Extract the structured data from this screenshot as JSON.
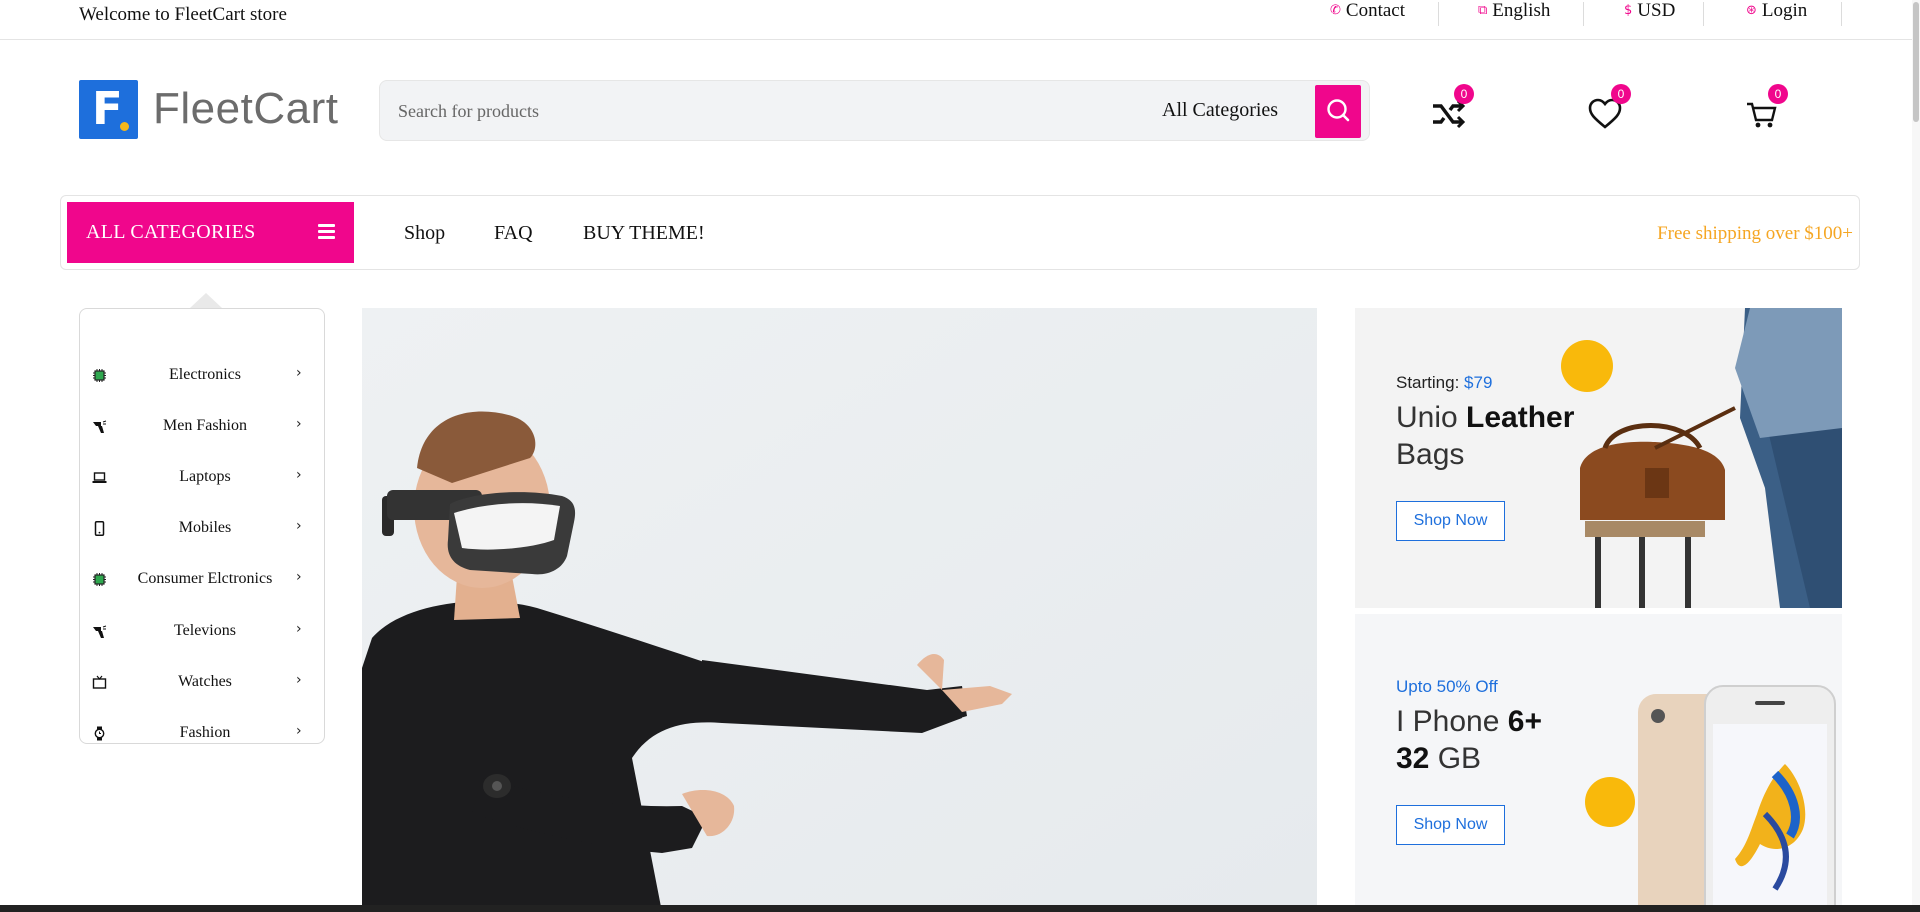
{
  "topbar": {
    "welcome": "Welcome to FleetCart store",
    "links": [
      {
        "label": "Contact",
        "icon": "phone-icon"
      },
      {
        "label": "English",
        "icon": "language-icon"
      },
      {
        "label": "USD",
        "icon": "dollar-icon"
      },
      {
        "label": "Login",
        "icon": "login-icon"
      }
    ]
  },
  "header": {
    "logo_text": "FleetCart",
    "search": {
      "placeholder": "Search for products",
      "category": "All Categories"
    },
    "badges": {
      "compare": "0",
      "wishlist": "0",
      "cart": "0"
    }
  },
  "nav": {
    "all_categories": "ALL CATEGORIES",
    "links": [
      "Shop",
      "FAQ",
      "BUY THEME!"
    ],
    "free_shipping": "Free shipping over $100+"
  },
  "categories": [
    {
      "label": "Electronics",
      "icon": "chip-icon"
    },
    {
      "label": "Men Fashion",
      "icon": "hair-dryer-icon"
    },
    {
      "label": "Laptops",
      "icon": "laptop-icon"
    },
    {
      "label": "Mobiles",
      "icon": "mobile-icon"
    },
    {
      "label": "Consumer Elctronics",
      "icon": "chip-icon"
    },
    {
      "label": "Televions",
      "icon": "hair-dryer-icon"
    },
    {
      "label": "Watches",
      "icon": "tv-icon"
    },
    {
      "label": "Fashion",
      "icon": "watch-icon"
    }
  ],
  "promos": [
    {
      "sub_prefix": "Starting: ",
      "sub_accent": "$79",
      "title_light": "Unio ",
      "title_bold": "Leather",
      "title_line2": "Bags",
      "button": "Shop Now"
    },
    {
      "sub_accent": "Upto 50% Off",
      "title_light": "I Phone ",
      "title_bold": "6+",
      "title_line2_bold": "32",
      "title_line2_light": " GB",
      "button": "Shop Now"
    }
  ],
  "colors": {
    "brand": "#f0068c",
    "accent_blue": "#1e6fdc",
    "shipping": "#f5a623",
    "dot_yellow": "#f9b90b"
  }
}
